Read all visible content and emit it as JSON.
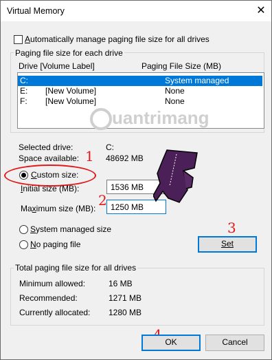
{
  "window": {
    "title": "Virtual Memory",
    "close_icon": "close-icon"
  },
  "auto_manage": {
    "label": "Automatically manage paging file size for all drives",
    "checked": false
  },
  "paging_group": {
    "title": "Paging file size for each drive",
    "col_drive": "Drive  [Volume Label]",
    "col_size": "Paging File Size (MB)",
    "rows": [
      {
        "drive": "C:",
        "label": "",
        "size": "System managed",
        "selected": true
      },
      {
        "drive": "E:",
        "label": "[New Volume]",
        "size": "None",
        "selected": false
      },
      {
        "drive": "F:",
        "label": "[New Volume]",
        "size": "None",
        "selected": false
      }
    ]
  },
  "selected_drive": {
    "label": "Selected drive:",
    "value": "C:"
  },
  "space_available": {
    "label": "Space available:",
    "value": "48692 MB"
  },
  "custom_size": {
    "label": "Custom size:",
    "selected": true
  },
  "initial_size": {
    "label": "Initial size (MB):",
    "value": "1536 MB"
  },
  "maximum_size": {
    "label": "Maximum size (MB):",
    "value": "1250 MB"
  },
  "system_managed": {
    "label": "System managed size",
    "selected": false
  },
  "no_paging": {
    "label": "No paging file",
    "selected": false
  },
  "set_button": {
    "label": "Set"
  },
  "total_group": {
    "title": "Total paging file size for all drives",
    "min_label": "Minimum allowed:",
    "min_value": "16 MB",
    "rec_label": "Recommended:",
    "rec_value": "1271 MB",
    "cur_label": "Currently allocated:",
    "cur_value": "1280 MB"
  },
  "ok_button": {
    "label": "OK"
  },
  "cancel_button": {
    "label": "Cancel"
  },
  "annotations": {
    "step1": "1",
    "step2": "2",
    "step3": "3",
    "step4": "4",
    "color": "#e0191c"
  },
  "watermark": {
    "text": "uantrimang"
  }
}
